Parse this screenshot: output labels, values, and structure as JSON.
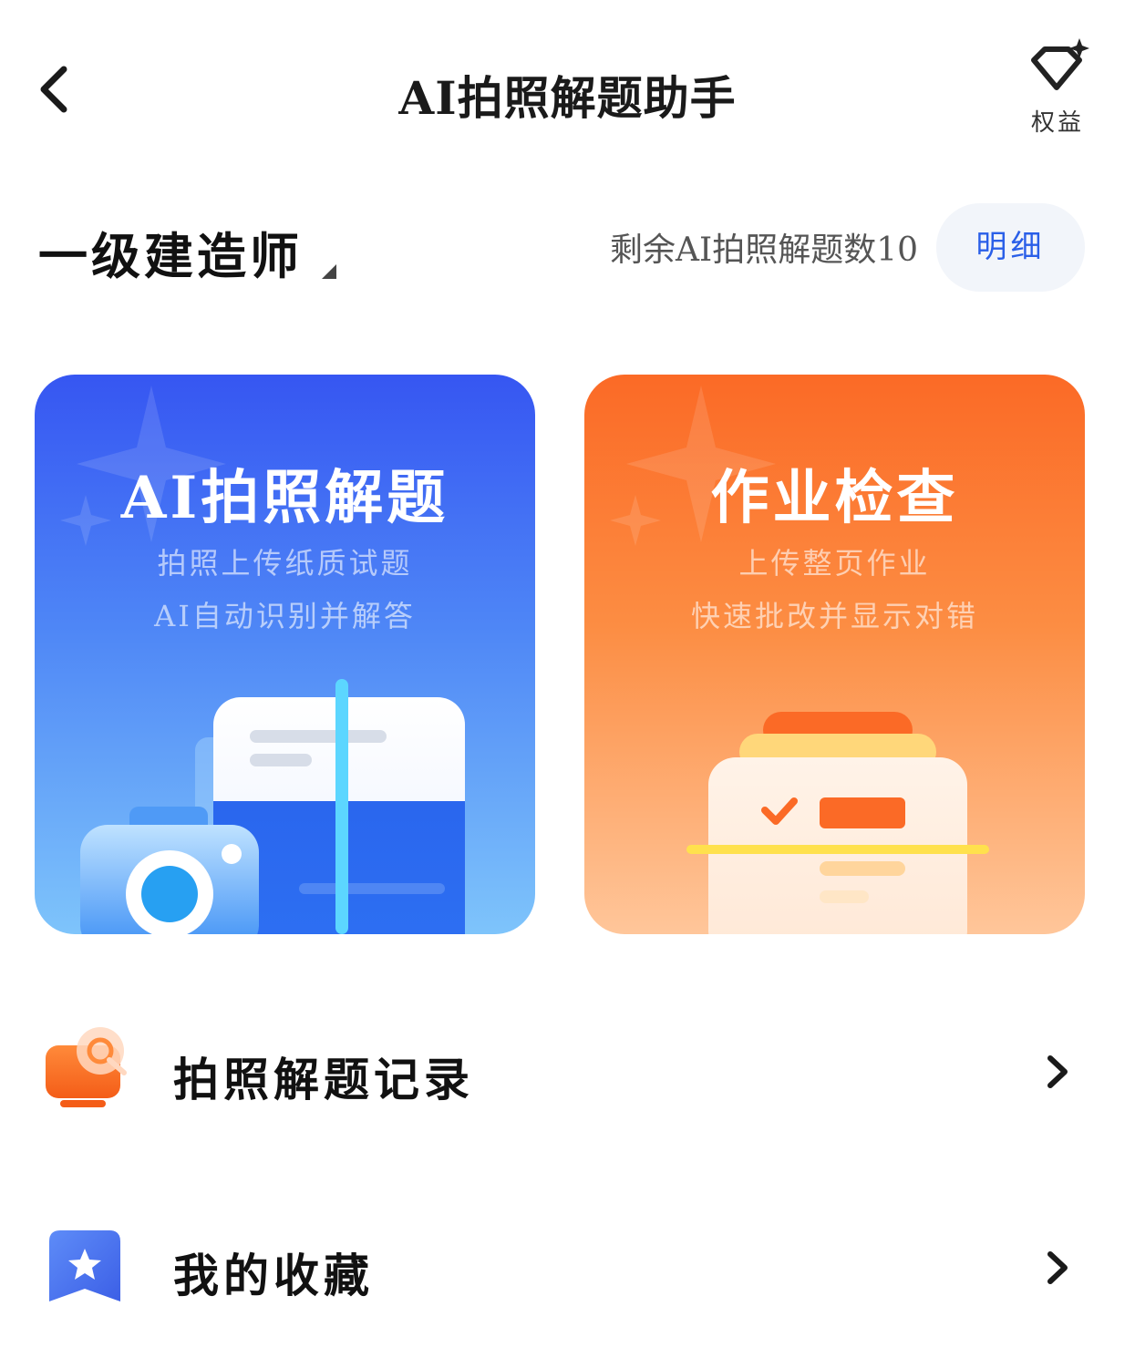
{
  "header": {
    "title": "AI拍照解题助手",
    "back_icon": "chevron-left-icon",
    "benefits_icon": "diamond-sparkle-icon",
    "benefits_label": "权益"
  },
  "exam": {
    "name": "一级建造师",
    "remaining_label": "剩余AI拍照解题数10",
    "detail_label": "明细"
  },
  "cards": {
    "ai_solve": {
      "title": "AI拍照解题",
      "line1": "拍照上传纸质试题",
      "line2": "AI自动识别并解答",
      "color_top": "#3656f2",
      "color_bottom": "#7ec4fb"
    },
    "homework_check": {
      "title": "作业检查",
      "line1": "上传整页作业",
      "line2": "快速批改并显示对错",
      "color_top": "#fb6a26",
      "color_bottom": "#ffc69a"
    }
  },
  "list": {
    "history": {
      "label": "拍照解题记录",
      "icon": "history-monitor-icon"
    },
    "favorites": {
      "label": "我的收藏",
      "icon": "bookmark-star-icon"
    }
  },
  "colors": {
    "accent_blue": "#2a5fe8",
    "accent_orange": "#fb6a26",
    "detail_bg": "#f2f5fa"
  }
}
